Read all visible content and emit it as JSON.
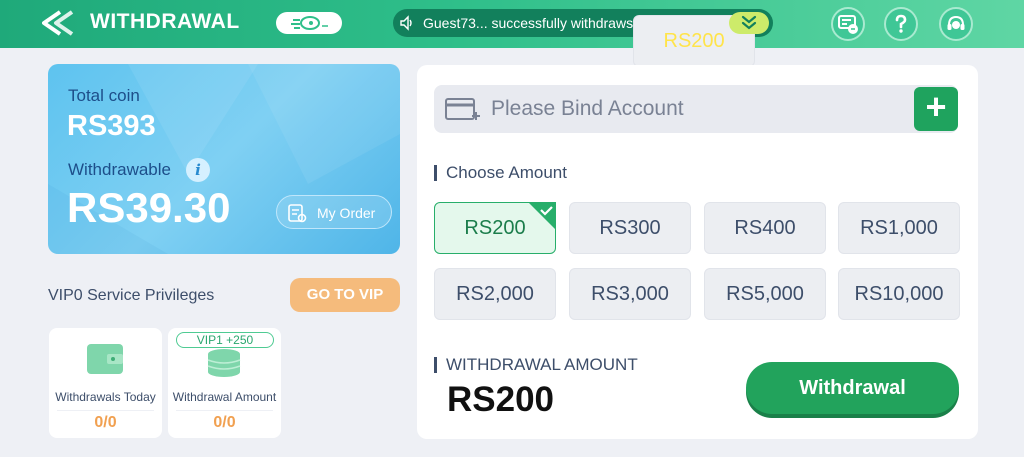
{
  "header": {
    "title": "WITHDRAWAL",
    "ticker": {
      "prefix": "Guest73... successfully withdraws ",
      "amount": "RS200"
    }
  },
  "wallet": {
    "total_label": "Total coin",
    "total_value": "RS393",
    "withdrawable_label": "Withdrawable",
    "withdrawable_value": "RS39.30",
    "info_glyph": "i",
    "my_order": "My Order"
  },
  "vip": {
    "label": "VIP0 Service Privileges",
    "go_vip": "GO TO VIP",
    "badge": "VIP1 +250",
    "stats": [
      {
        "name": "Withdrawals Today",
        "value": "0/0"
      },
      {
        "name": "Withdrawal Amount",
        "value": "0/0"
      }
    ]
  },
  "account": {
    "placeholder": "Please Bind Account",
    "add": "+"
  },
  "choose": {
    "label": "Choose Amount",
    "amounts": [
      "RS200",
      "RS300",
      "RS400",
      "RS1,000",
      "RS2,000",
      "RS3,000",
      "RS5,000",
      "RS10,000"
    ],
    "selected_index": 0
  },
  "summary": {
    "label": "WITHDRAWAL AMOUNT",
    "value": "RS200",
    "button": "Withdrawal"
  },
  "colors": {
    "brand": "#1fa97a",
    "button": "#22a35c",
    "vip": "#f5bb7c",
    "ticker_amount": "#ffe44a"
  }
}
